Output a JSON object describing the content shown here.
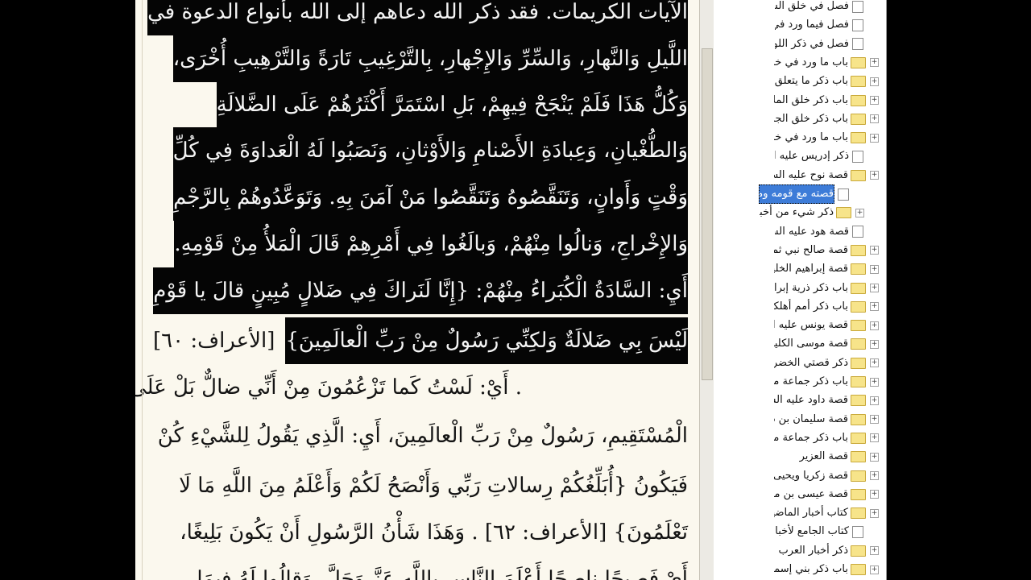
{
  "reader": {
    "lines": [
      {
        "text": "الآيات الكريمات. فقد ذكر الله دعاهم إلى الله بأنواع الدعوة في",
        "sel": true
      },
      {
        "text": "اللَّيلِ وَالنَّهارِ، وَالسِّرِّ وَالإِجْهارِ، بِالتَّرْغِيبِ تَارَةً وَالتَّرْهِيبِ أُخْرَى،",
        "sel": true
      },
      {
        "text": "وَكُلُّ هَذَا فَلَمْ يَنْجَحْ فِيهِمْ، بَلِ اسْتَمَرَّ أَكْثَرُهُمْ عَلَى الضَّلالَةِ",
        "sel": true
      },
      {
        "text": "وَالطُّغْيانِ، وَعِبادَةِ الأَصْنامِ وَالأَوْثانِ، وَنَصَبُوا لَهُ الْعَداوَةَ فِي كُلِّ",
        "sel": true
      },
      {
        "text": "وَقْتٍ وَأَوانٍ، وَتَنَقَّصُوهُ وَتَنَقَّصُوا مَنْ آمَنَ بِهِ. وَتَوَعَّدُوهُمْ بِالرَّجْمِ",
        "sel": true
      },
      {
        "text": "وَالإِخْراجِ، وَنالُوا مِنْهُمْ، وَبالَغُوا فِي أَمْرِهِمْ قَالَ الْمَلأُ مِنْ قَوْمِهِ.",
        "sel": true
      },
      {
        "text": "أَيِ: السَّادَةُ الْكُبَراءُ مِنْهُمْ: {إِنَّا لَنَراكَ فِي ضَلالٍ مُبِينٍ قالَ يا قَوْمِ",
        "sel": true
      },
      {
        "text": "[الأعراف: ٦٠]",
        "sel": false
      },
      {
        "text": "لَيْسَ بِي ضَلالَةٌ وَلكِنِّي رَسُولٌ مِنْ رَبِّ الْعالَمِينَ}",
        "sel": true
      },
      {
        "text": ". أَيْ: لَسْتُ كَما تَزْعُمُونَ مِنْ أَنِّي ضالٌّ بَلْ عَلَى الْهُدَى",
        "sel": false
      },
      {
        "text": "الْمُسْتَقِيمِ، رَسُولٌ مِنْ رَبِّ الْعالَمِينَ، أَيِ: الَّذِي يَقُولُ لِلشَّيْءِ كُنْ",
        "sel": false
      },
      {
        "text": "فَيَكُونُ {أُبَلِّغُكُمْ رِسالاتِ رَبِّي وَأَنْصَحُ لَكُمْ وَأَعْلَمُ مِنَ اللَّهِ مَا لَا",
        "sel": false
      },
      {
        "text": "تَعْلَمُونَ} [الأعراف: ٦٢] . وَهَذَا شَأْنُ الرَّسُولِ أَنْ يَكُونَ بَلِيغًا،",
        "sel": false
      },
      {
        "text": "أَيْ فَصِيحًا ناصِحًا أَعْلَمَ النَّاسِ بِاللَّهِ عَزَّ وَجَلَّ. وَقالُوا لَهُ فِيمَا",
        "sel": false
      }
    ]
  },
  "tree": {
    "items": [
      {
        "label": "فصل في خلق السماوات",
        "kind": "page",
        "expander": false,
        "selected": false
      },
      {
        "label": "فصل فيما ورد في خلق",
        "kind": "page",
        "expander": false,
        "selected": false
      },
      {
        "label": "فصل في ذكر اللوح",
        "kind": "page",
        "expander": false,
        "selected": false
      },
      {
        "label": "باب ما ورد في خلق",
        "kind": "folder",
        "expander": true,
        "selected": false
      },
      {
        "label": "باب ذكر ما يتعلق بخلق",
        "kind": "folder",
        "expander": true,
        "selected": false
      },
      {
        "label": "باب ذكر خلق الملائكة",
        "kind": "folder",
        "expander": true,
        "selected": false
      },
      {
        "label": "باب ذكر خلق الجان",
        "kind": "folder",
        "expander": true,
        "selected": false
      },
      {
        "label": "باب ما ورد في خلق",
        "kind": "folder",
        "expander": true,
        "selected": false
      },
      {
        "label": "ذكر إدريس عليه السلام",
        "kind": "page",
        "expander": false,
        "selected": false
      },
      {
        "label": "قصة نوح عليه السلام",
        "kind": "folder",
        "expander": true,
        "selected": false
      },
      {
        "label": "قصته مع قومه وما",
        "kind": "page",
        "expander": false,
        "selected": true
      },
      {
        "label": "ذكر شيء من أخباره",
        "kind": "folder",
        "expander": true,
        "selected": false
      },
      {
        "label": "قصة هود عليه السلام",
        "kind": "page",
        "expander": false,
        "selected": false
      },
      {
        "label": "قصة صالح نبي ثمود",
        "kind": "folder",
        "expander": true,
        "selected": false
      },
      {
        "label": "قصة إبراهيم الخليل",
        "kind": "folder",
        "expander": true,
        "selected": false
      },
      {
        "label": "باب ذكر ذرية إبراهيم",
        "kind": "folder",
        "expander": true,
        "selected": false
      },
      {
        "label": "باب ذكر أمم أهلكوا",
        "kind": "folder",
        "expander": true,
        "selected": false
      },
      {
        "label": "قصة يونس عليه الصلاة",
        "kind": "folder",
        "expander": true,
        "selected": false
      },
      {
        "label": "قصة موسى الكليم عليه",
        "kind": "folder",
        "expander": true,
        "selected": false
      },
      {
        "label": "ذكر قصتي الخضر وإلياس",
        "kind": "folder",
        "expander": true,
        "selected": false
      },
      {
        "label": "باب ذكر جماعة من أنبياء",
        "kind": "folder",
        "expander": true,
        "selected": false
      },
      {
        "label": "قصة داود عليه السلام",
        "kind": "folder",
        "expander": true,
        "selected": false
      },
      {
        "label": "قصة سليمان بن داود",
        "kind": "folder",
        "expander": true,
        "selected": false
      },
      {
        "label": "باب ذكر جماعة من أنبياء",
        "kind": "folder",
        "expander": true,
        "selected": false
      },
      {
        "label": "قصة العزير",
        "kind": "folder",
        "expander": true,
        "selected": false
      },
      {
        "label": "قصة زكريا ويحيى",
        "kind": "folder",
        "expander": true,
        "selected": false
      },
      {
        "label": "قصة عيسى بن مريم",
        "kind": "folder",
        "expander": true,
        "selected": false
      },
      {
        "label": "كتاب أخبار الماضين",
        "kind": "folder",
        "expander": true,
        "selected": false
      },
      {
        "label": "كتاب الجامع لأخبار",
        "kind": "page",
        "expander": false,
        "selected": false
      },
      {
        "label": "ذكر أخبار العرب",
        "kind": "folder",
        "expander": true,
        "selected": false
      },
      {
        "label": "باب ذكر بني إسماعيل",
        "kind": "folder",
        "expander": true,
        "selected": false
      }
    ]
  },
  "colors": {
    "selection": "#050505",
    "paper": "#fbf8ee",
    "tree_highlight": "#3d7cd8"
  }
}
